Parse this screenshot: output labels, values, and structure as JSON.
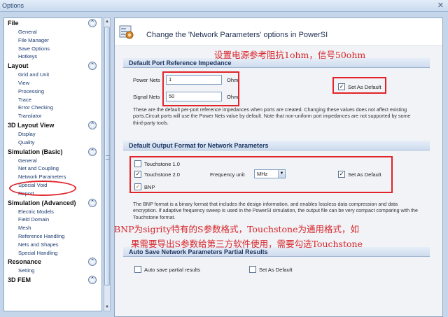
{
  "window": {
    "title": "Options",
    "close_glyph": "✕"
  },
  "nav": {
    "sections": [
      {
        "title": "File",
        "items": [
          "General",
          "File Manager",
          "Save Options",
          "Hotkeys"
        ]
      },
      {
        "title": "Layout",
        "items": [
          "Grid and Unit",
          "View",
          "Processing",
          "Trace",
          "Error Checking",
          "Translator"
        ]
      },
      {
        "title": "3D Layout View",
        "items": [
          "Display",
          "Quality"
        ]
      },
      {
        "title": "Simulation (Basic)",
        "items": [
          "General",
          "Net and Coupling",
          "Network Parameters",
          "Special Void",
          "Report"
        ]
      },
      {
        "title": "Simulation (Advanced)",
        "items": [
          "Electric Models",
          "Field Domain",
          "Mesh",
          "Reference Handling",
          "Nets and Shapes",
          "Special Handling"
        ]
      },
      {
        "title": "Resonance",
        "items": [
          "Setting"
        ]
      },
      {
        "title": "3D FEM",
        "items": []
      }
    ],
    "chevron_glyph": "⌃",
    "selected_item": "Network Parameters"
  },
  "main": {
    "header_text": "Change the 'Network Parameters' options in PowerSI",
    "port_ref": {
      "heading": "Default Port Reference Impedance",
      "power_label": "Power Nets",
      "power_value": "1",
      "signal_label": "Signal Nets",
      "signal_value": "50",
      "unit": "Ohm",
      "set_default_label": "Set As Default",
      "description": "These are the default per-port reference impedances when ports are created.  Changing these values does not affect existing ports.Circuit ports will use the Power Nets value by default. Note that non-uniform port impedances are not supported by some third-party tools."
    },
    "output_format": {
      "heading": "Default Output Format for Network Parameters",
      "touchstone1_label": "Touchstone 1.0",
      "touchstone2_label": "Touchstone 2.0",
      "bnp_label": "BNP",
      "freq_unit_label": "Frequency unit",
      "freq_unit_value": "MHz",
      "set_default_label": "Set As Default",
      "description": "The BNP format is a binary format that includes the design information, and enables lossless data compression and data encryption. If adaptive frequency sweep is used in the PowerSI simulation, the output file can be very compact comparing with the Touchstone format."
    },
    "auto_save": {
      "heading": "Auto Save Network Parameters Partial Results",
      "auto_save_label": "Auto save partial results",
      "set_default_label": "Set As Default"
    }
  },
  "annotations": {
    "impedance_note": "设置电源参考阻抗1ohm，信号50ohm",
    "bnp_note_line1": "BNP为sigrity特有的S参数格式，Touchstone为通用格式，如",
    "bnp_note_line2": "果需要导出S参数给第三方软件使用，需要勾选Touchstone"
  },
  "colors": {
    "annotation_red": "#e0242a",
    "header_blue": "#1c3560",
    "link_blue": "#1b3a70"
  }
}
